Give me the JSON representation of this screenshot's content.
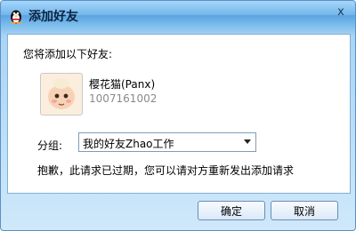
{
  "window": {
    "title": "添加好友",
    "close_label": "x"
  },
  "content": {
    "prompt": "您将添加以下好友:",
    "friend": {
      "name": "樱花猫(Panx)",
      "qq_number": "1007161002"
    },
    "group": {
      "label": "分组:",
      "selected": "我的好友Zhao工作"
    },
    "message": "抱歉，此请求已过期，您可以请对方重新发出添加请求"
  },
  "buttons": {
    "ok": "确定",
    "cancel": "取消"
  },
  "icons": {
    "app": "qq-penguin-icon",
    "avatar": "baby-avatar"
  }
}
